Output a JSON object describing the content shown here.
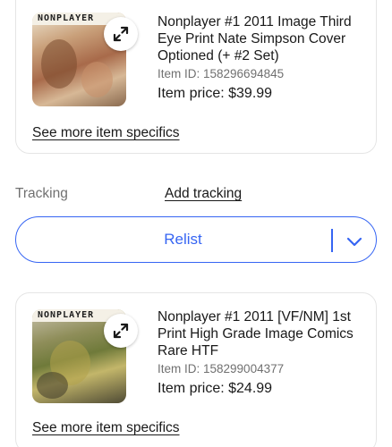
{
  "items": [
    {
      "cover_title": "NONPLAYER",
      "title": "Nonplayer #1 2011 Image Third Eye Print Nate Simpson  Cover Optioned (+ #2 Set)",
      "item_id": "Item ID: 158296694845",
      "price": "Item price: $39.99",
      "see_more_label": "See more item specifics",
      "expand_icon": "expand-arrows-icon"
    },
    {
      "cover_title": "NONPLAYER",
      "title": "Nonplayer #1 2011 [VF/NM] 1st Print High Grade Image Comics Rare HTF",
      "item_id": "Item ID: 158299004377",
      "price": "Item price: $24.99",
      "see_more_label": "See more item specifics",
      "expand_icon": "expand-arrows-icon"
    }
  ],
  "tracking": {
    "label": "Tracking",
    "add_label": "Add tracking"
  },
  "relist": {
    "label": "Relist",
    "menu_icon": "chevron-down-icon"
  },
  "colors": {
    "accent": "#3665f3",
    "text": "#191919",
    "muted": "#707070",
    "border": "#e5e5e5"
  }
}
